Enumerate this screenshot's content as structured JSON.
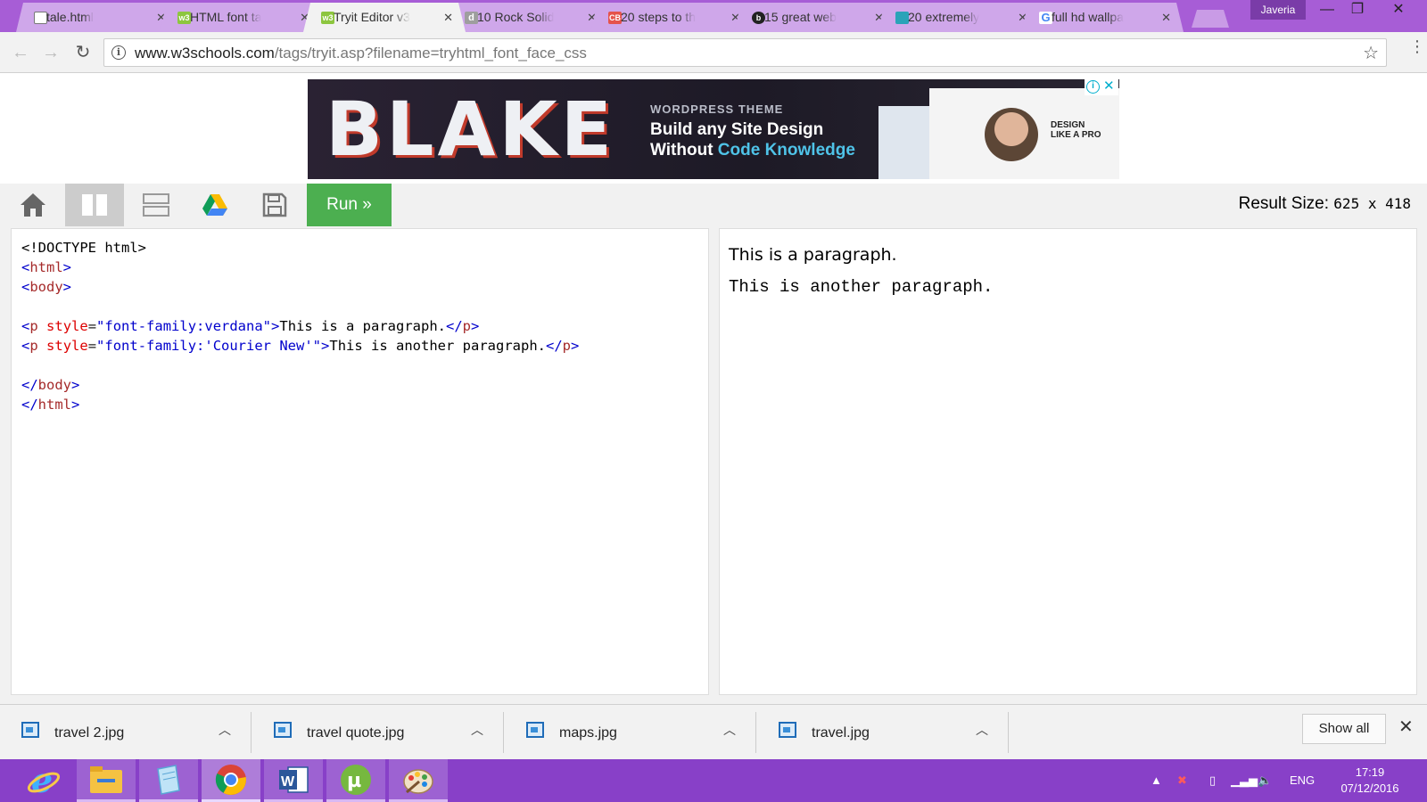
{
  "browser": {
    "tabs": [
      {
        "title": "tale.html",
        "favicon": "document-icon",
        "color": "#ffffff"
      },
      {
        "title": "HTML font ta",
        "favicon": "w3schools-icon",
        "color": "#8dc63f"
      },
      {
        "title": "Tryit Editor v3",
        "favicon": "w3schools-icon",
        "color": "#8dc63f",
        "active": true
      },
      {
        "title": "10 Rock Solid",
        "favicon": "d-icon",
        "color": "#9e9e9e"
      },
      {
        "title": "20 steps to th",
        "favicon": "cb-icon",
        "color": "#e5534b"
      },
      {
        "title": "15 great web",
        "favicon": "b-icon",
        "color": "#222222"
      },
      {
        "title": "20 extremely",
        "favicon": "square-icon",
        "color": "#2aa3b8"
      },
      {
        "title": "full hd wallpa",
        "favicon": "google-icon",
        "color": "#4285f4"
      }
    ],
    "profile_name": "Javeria",
    "url_host": "www.w3schools.com",
    "url_path": "/tags/tryit.asp?filename=tryhtml_font_face_css"
  },
  "ad": {
    "brand": "BLAKE",
    "theme_label": "WORDPRESS THEME",
    "line1": "Build any Site Design",
    "line2_prefix": "Without ",
    "line2_highlight": "Code Knowledge",
    "promo_line1": "DESIGN",
    "promo_line2": "LIKE A PRO"
  },
  "tryit": {
    "run_label": "Run »",
    "result_label": "Result Size:",
    "result_value": "625 x 418"
  },
  "code": {
    "doctype": "<!DOCTYPE html>",
    "p_tag": "p",
    "style_attr": "style",
    "p1_style": "\"font-family:verdana\"",
    "p1_text": "This is a paragraph.",
    "p2_style": "\"font-family:'Courier New'\"",
    "p2_text": "This is another paragraph."
  },
  "result": {
    "paragraph1": "This is a paragraph.",
    "paragraph2": "This is another paragraph."
  },
  "downloads": {
    "items": [
      "travel 2.jpg",
      "travel quote.jpg",
      "maps.jpg",
      "travel.jpg"
    ],
    "show_all_label": "Show all"
  },
  "taskbar": {
    "apps": [
      "internet-explorer-icon",
      "file-explorer-icon",
      "notepad-icon",
      "chrome-icon",
      "word-icon",
      "utorrent-icon",
      "paint-icon"
    ],
    "language": "ENG",
    "time": "17:19",
    "date": "07/12/2016"
  },
  "colors": {
    "tabstrip": "#a75dd6",
    "taskbar": "#8840c8",
    "run_button": "#4caf50"
  }
}
